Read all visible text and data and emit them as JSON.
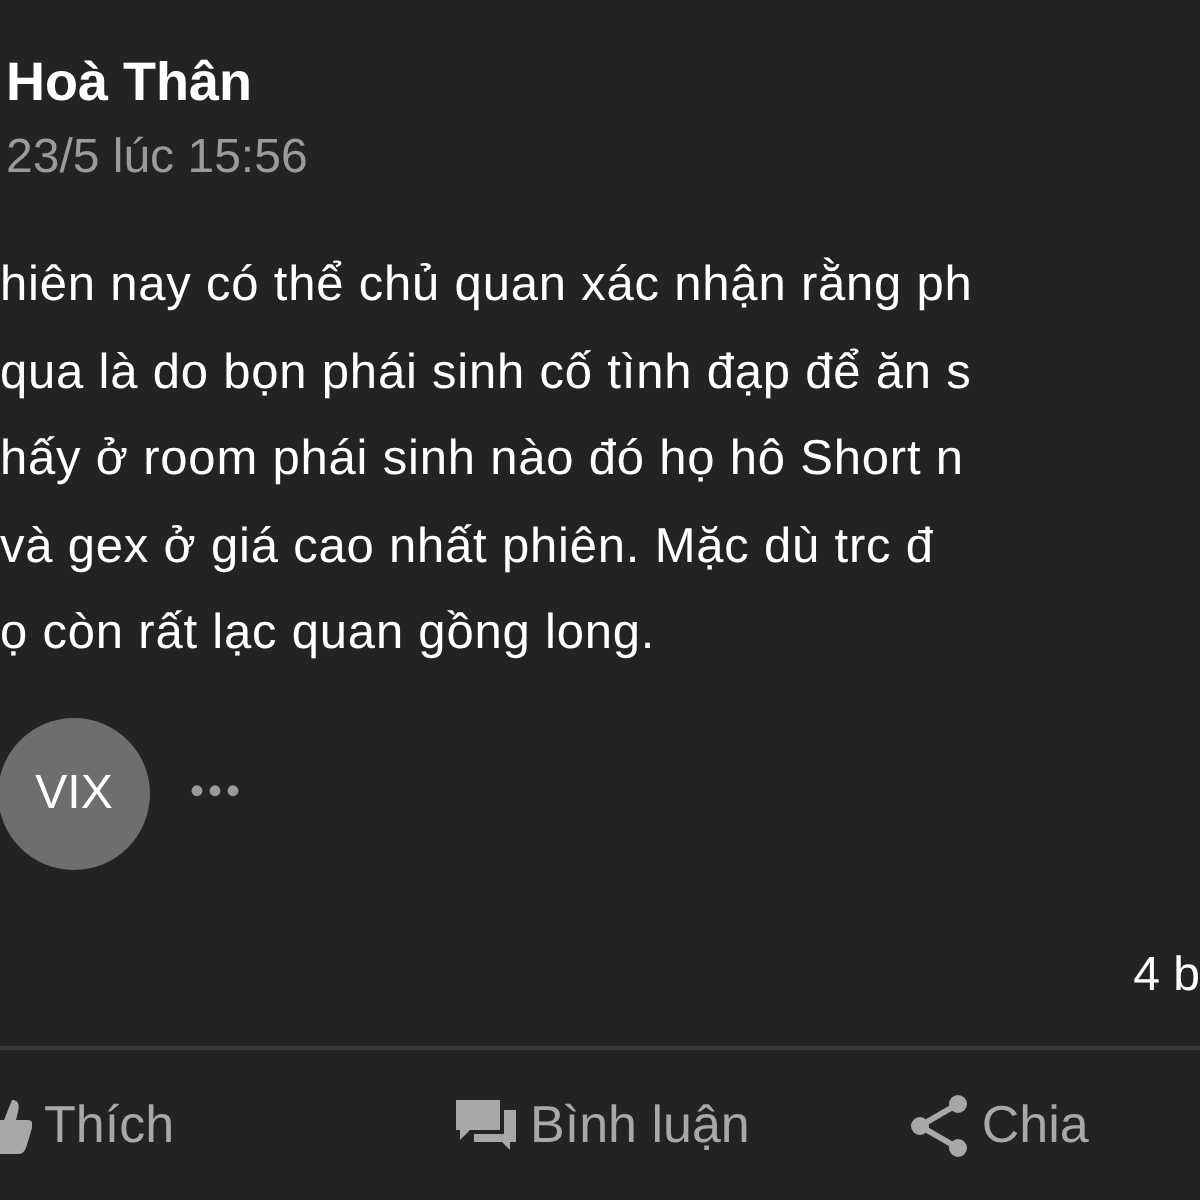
{
  "post": {
    "author": "Hoà Thân",
    "time": "23/5 lúc 15:56",
    "body_lines": [
      "hiên nay có thể chủ quan xác nhận rằng ph",
      "qua là do bọn phái sinh cố tình đạp để ăn s",
      "hấy ở room phái sinh nào đó họ hô Short n",
      "và gex ở giá cao nhất phiên. Mặc dù trc đ",
      "ọ còn rất lạc quan gồng long."
    ],
    "tag": "VIX",
    "more": "•••",
    "comment_count": "4 b"
  },
  "actions": [
    {
      "kind": "like",
      "label": "Thích"
    },
    {
      "kind": "comment",
      "label": "Bình luận"
    },
    {
      "kind": "share",
      "label": "Chia"
    }
  ]
}
